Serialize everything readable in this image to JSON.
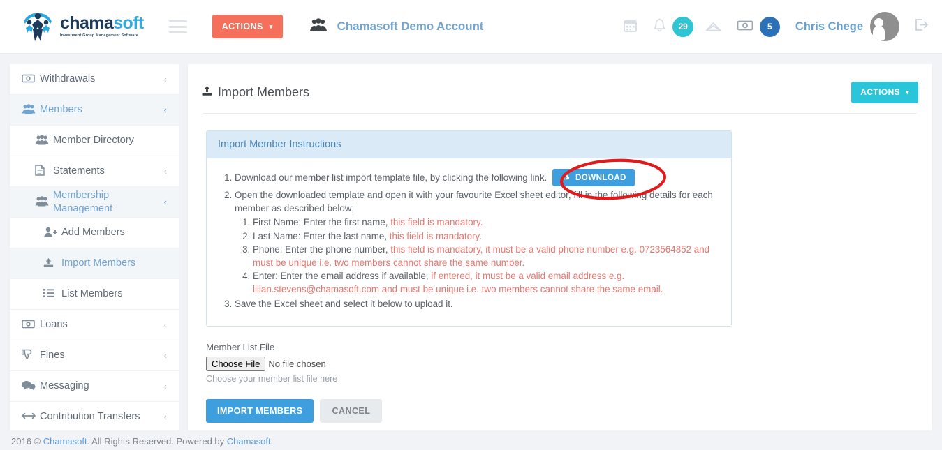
{
  "brand": {
    "logo_word_a": "chama",
    "logo_word_b": "soft",
    "logo_tagline": "Investment Group Management Software",
    "accent_red": "#f4705a",
    "accent_teal": "#2ac5d8",
    "accent_blue": "#3e9ede"
  },
  "topbar": {
    "menu_icon": "hamburger-icon",
    "actions_label": "ACTIONS",
    "actions_caret": "⌄",
    "account_icon": "group-icon",
    "account_name": "Chamasoft Demo Account",
    "calendar_icon": "☷",
    "bell_icon": "bell-icon",
    "bell_badge": "29",
    "mail_icon": "envelope-icon",
    "money_icon": "banknote-icon",
    "money_badge": "5",
    "user_name": "Chris Chege",
    "logout_icon": "logout-icon"
  },
  "sidebar": {
    "items": [
      {
        "label": "Withdrawals",
        "icon": "banknote-icon",
        "chevron": "‹",
        "level": 0,
        "active": false,
        "name": "withdrawals"
      },
      {
        "label": "Members",
        "icon": "group-icon",
        "chevron": "‹",
        "level": 0,
        "active": true,
        "name": "members"
      },
      {
        "label": "Member Directory",
        "icon": "group-icon",
        "chevron": "",
        "level": 1,
        "active": false,
        "name": "member-directory"
      },
      {
        "label": "Statements",
        "icon": "document-icon",
        "chevron": "‹",
        "level": 1,
        "active": false,
        "name": "statements"
      },
      {
        "label": "Membership Management",
        "icon": "group-icon",
        "chevron": "‹",
        "level": 1,
        "active": true,
        "name": "membership-management"
      },
      {
        "label": "Add Members",
        "icon": "user-plus-icon",
        "chevron": "",
        "level": 2,
        "active": false,
        "name": "add-members"
      },
      {
        "label": "Import Members",
        "icon": "upload-icon",
        "chevron": "",
        "level": 2,
        "active": true,
        "name": "import-members"
      },
      {
        "label": "List Members",
        "icon": "list-icon",
        "chevron": "",
        "level": 2,
        "active": false,
        "name": "list-members"
      },
      {
        "label": "Loans",
        "icon": "banknote-icon",
        "chevron": "‹",
        "level": 0,
        "active": false,
        "name": "loans"
      },
      {
        "label": "Fines",
        "icon": "thumbs-down-icon",
        "chevron": "‹",
        "level": 0,
        "active": false,
        "name": "fines"
      },
      {
        "label": "Messaging",
        "icon": "chat-icon",
        "chevron": "‹",
        "level": 0,
        "active": false,
        "name": "messaging"
      },
      {
        "label": "Contribution Transfers",
        "icon": "arrows-icon",
        "chevron": "‹",
        "level": 0,
        "active": false,
        "name": "contribution-transfers"
      }
    ]
  },
  "page": {
    "title": "Import Members",
    "title_icon": "upload-icon",
    "actions_label": "ACTIONS",
    "actions_caret": "⌄"
  },
  "instructions": {
    "heading": "Import Member Instructions",
    "step1_text": "Download our member list import template file, by clicking the following link.",
    "download_label": "DOWNLOAD",
    "download_icon": "cloud-download-icon",
    "step2_text": "Open the downloaded template and open it with your favourite Excel sheet editor, fill in the following details for each member as described below;",
    "sub_steps": [
      {
        "plain": "First Name: Enter the first name, ",
        "red": "this field is mandatory."
      },
      {
        "plain": "Last Name: Enter the last name, ",
        "red": "this field is mandatory."
      },
      {
        "plain": "Phone: Enter the phone number, ",
        "red": "this field is mandatory, it must be a valid phone number e.g. 0723564852 and must be unique i.e. two members cannot share the same number."
      },
      {
        "plain": "Enter: Enter the email address if available, ",
        "red": "if entered, it must be a valid email address e.g. lilian.stevens@chamasoft.com and must be unique i.e. two members cannot share the same email."
      }
    ],
    "step3_text": "Save the Excel sheet and select it below to upload it."
  },
  "form": {
    "file_label": "Member List File",
    "file_button_label": "Choose File",
    "file_status": "No file chosen",
    "file_help": "Choose your member list file here",
    "submit_label": "IMPORT MEMBERS",
    "cancel_label": "CANCEL"
  },
  "annotation": {
    "shape": "red-ellipse",
    "color": "#e01b1b",
    "target": "download-button"
  },
  "footer": {
    "text_before": "2016 © ",
    "link1": "Chamasoft",
    "text_mid": ". All Rights Reserved. Powered by ",
    "link2": "Chamasoft",
    "text_after": "."
  }
}
